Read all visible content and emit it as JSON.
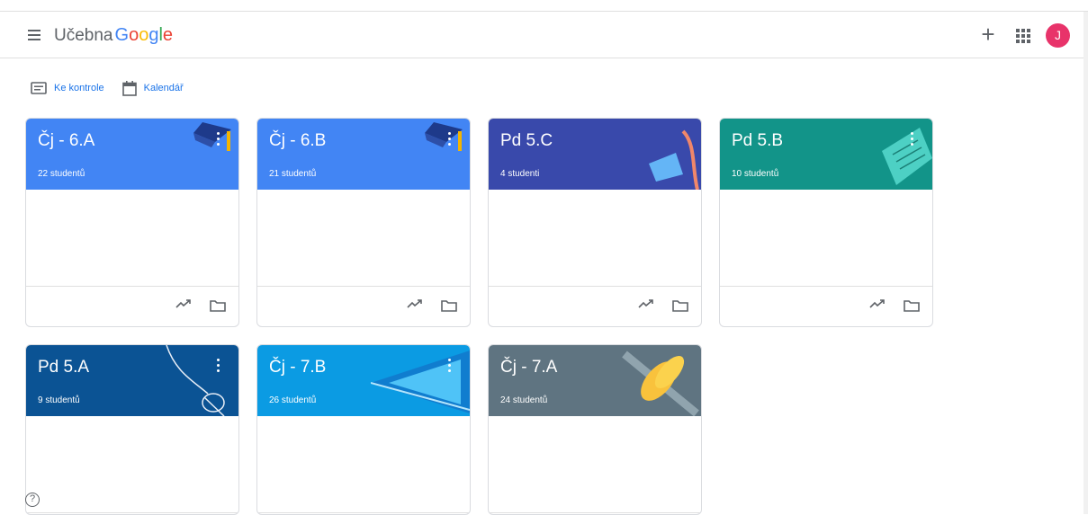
{
  "header": {
    "app_name": "Učebna",
    "google_letters": [
      "G",
      "o",
      "o",
      "g",
      "l",
      "e"
    ],
    "add_label": "+",
    "avatar_initial": "J"
  },
  "subnav": {
    "review_label": "Ke kontrole",
    "calendar_label": "Kalendář"
  },
  "classes": [
    {
      "title": "Čj - 6.A",
      "students": "22 studentů",
      "color": "#4285f4",
      "theme": "graduation-cap"
    },
    {
      "title": "Čj - 6.B",
      "students": "21 studentů",
      "color": "#4285f4",
      "theme": "graduation-cap"
    },
    {
      "title": "Pd 5.C",
      "students": "4 studenti",
      "color": "#3949ab",
      "theme": "paper"
    },
    {
      "title": "Pd 5.B",
      "students": "10 studentů",
      "color": "#129489",
      "theme": "notebook"
    },
    {
      "title": "Pd 5.A",
      "students": "9 studentů",
      "color": "#0b5394",
      "theme": "curve"
    },
    {
      "title": "Čj - 7.B",
      "students": "26 studentů",
      "color": "#0b9be3",
      "theme": "pool"
    },
    {
      "title": "Čj - 7.A",
      "students": "24 studentů",
      "color": "#5f7481",
      "theme": "barbell"
    }
  ],
  "help_label": "?"
}
